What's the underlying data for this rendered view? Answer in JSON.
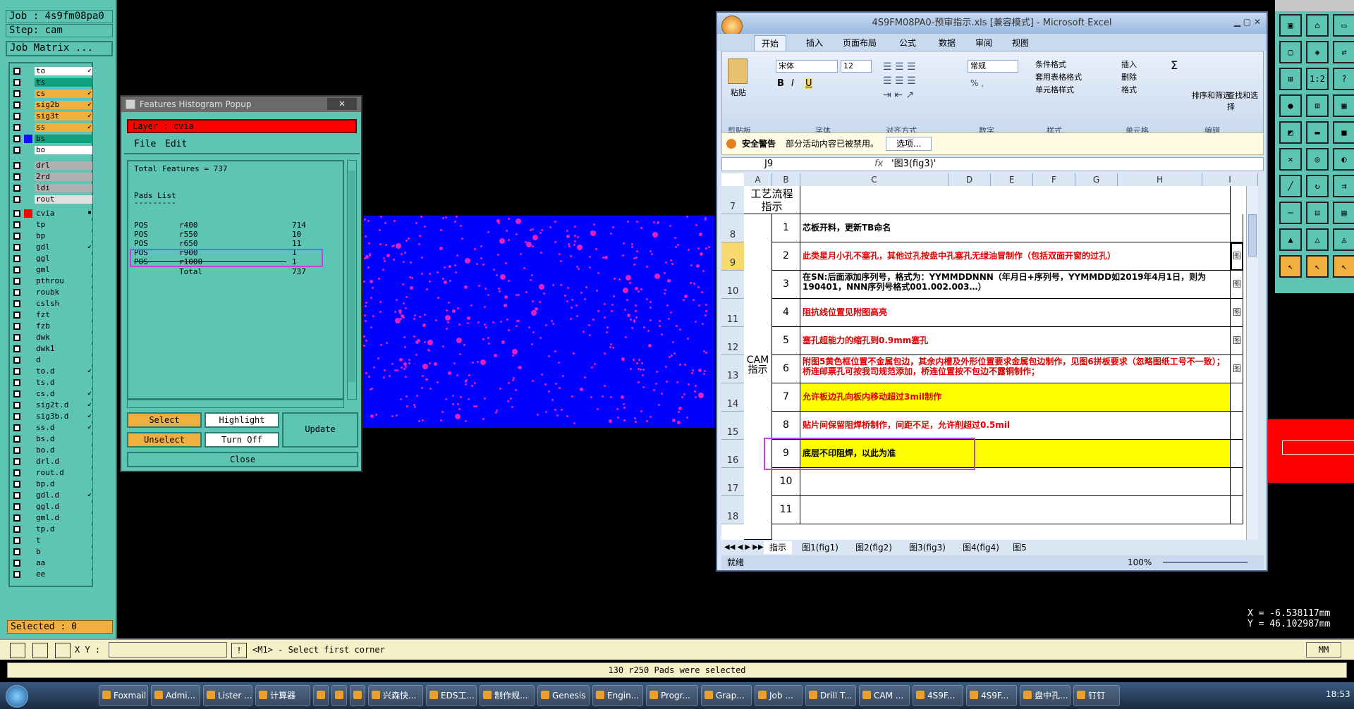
{
  "genesis": {
    "job": "Job : 4s9fm08pa0",
    "step": "Step: cam",
    "matrix": "Job Matrix ...",
    "selected": "Selected : 0",
    "layers": [
      {
        "name": "to",
        "bg": "#ffffff",
        "sw": "",
        "mk": "↙"
      },
      {
        "name": "ts",
        "bg": "#10a080",
        "sw": "",
        "mk": ""
      },
      {
        "name": "cs",
        "bg": "#f0b040",
        "sw": "",
        "mk": "↙"
      },
      {
        "name": "sig2b",
        "bg": "#f0b040",
        "sw": "",
        "mk": "↙"
      },
      {
        "name": "sig3t",
        "bg": "#f0b040",
        "sw": "",
        "mk": "↙"
      },
      {
        "name": "ss",
        "bg": "#f0b040",
        "sw": "",
        "mk": "↙"
      },
      {
        "name": "bs",
        "bg": "#10a080",
        "sw": "#1010ff",
        "mk": ""
      },
      {
        "name": "bo",
        "bg": "#ffffff",
        "sw": "",
        "mk": ""
      },
      {
        "name": "drl",
        "bg": "#b0b0b0",
        "sw": "",
        "mk": ""
      },
      {
        "name": "2rd",
        "bg": "#b0b0b0",
        "sw": "",
        "mk": ""
      },
      {
        "name": "ldi",
        "bg": "#b0b0b0",
        "sw": "",
        "mk": ""
      },
      {
        "name": "rout",
        "bg": "#e0e0e0",
        "sw": "",
        "mk": ""
      },
      {
        "name": "cvia",
        "bg": "#5ec4b4",
        "sw": "#ff0000",
        "mk": "▪"
      },
      {
        "name": "tp",
        "bg": "#5ec4b4",
        "sw": "",
        "mk": ""
      },
      {
        "name": "bp",
        "bg": "#5ec4b4",
        "sw": "",
        "mk": ""
      },
      {
        "name": "gdl",
        "bg": "#5ec4b4",
        "sw": "",
        "mk": "↙"
      },
      {
        "name": "ggl",
        "bg": "#5ec4b4",
        "sw": "",
        "mk": ""
      },
      {
        "name": "gml",
        "bg": "#5ec4b4",
        "sw": "",
        "mk": ""
      },
      {
        "name": "pthrou",
        "bg": "#5ec4b4",
        "sw": "",
        "mk": ""
      },
      {
        "name": "roubk",
        "bg": "#5ec4b4",
        "sw": "",
        "mk": ""
      },
      {
        "name": "cslsh",
        "bg": "#5ec4b4",
        "sw": "",
        "mk": ""
      },
      {
        "name": "fzt",
        "bg": "#5ec4b4",
        "sw": "",
        "mk": ""
      },
      {
        "name": "fzb",
        "bg": "#5ec4b4",
        "sw": "",
        "mk": ""
      },
      {
        "name": "dwk",
        "bg": "#5ec4b4",
        "sw": "",
        "mk": ""
      },
      {
        "name": "dwk1",
        "bg": "#5ec4b4",
        "sw": "",
        "mk": ""
      },
      {
        "name": "d",
        "bg": "#5ec4b4",
        "sw": "",
        "mk": ""
      },
      {
        "name": "to.d",
        "bg": "#5ec4b4",
        "sw": "",
        "mk": "↙"
      },
      {
        "name": "ts.d",
        "bg": "#5ec4b4",
        "sw": "",
        "mk": ""
      },
      {
        "name": "cs.d",
        "bg": "#5ec4b4",
        "sw": "",
        "mk": "↙"
      },
      {
        "name": "sig2t.d",
        "bg": "#5ec4b4",
        "sw": "",
        "mk": "↙"
      },
      {
        "name": "sig3b.d",
        "bg": "#5ec4b4",
        "sw": "",
        "mk": "↙"
      },
      {
        "name": "ss.d",
        "bg": "#5ec4b4",
        "sw": "",
        "mk": "↙"
      },
      {
        "name": "bs.d",
        "bg": "#5ec4b4",
        "sw": "",
        "mk": ""
      },
      {
        "name": "bo.d",
        "bg": "#5ec4b4",
        "sw": "",
        "mk": ""
      },
      {
        "name": "drl.d",
        "bg": "#5ec4b4",
        "sw": "",
        "mk": ""
      },
      {
        "name": "rout.d",
        "bg": "#5ec4b4",
        "sw": "",
        "mk": ""
      },
      {
        "name": "bp.d",
        "bg": "#5ec4b4",
        "sw": "",
        "mk": ""
      },
      {
        "name": "gdl.d",
        "bg": "#5ec4b4",
        "sw": "",
        "mk": "↙"
      },
      {
        "name": "ggl.d",
        "bg": "#5ec4b4",
        "sw": "",
        "mk": ""
      },
      {
        "name": "gml.d",
        "bg": "#5ec4b4",
        "sw": "",
        "mk": ""
      },
      {
        "name": "tp.d",
        "bg": "#5ec4b4",
        "sw": "",
        "mk": ""
      },
      {
        "name": "t",
        "bg": "#5ec4b4",
        "sw": "",
        "mk": ""
      },
      {
        "name": "b",
        "bg": "#5ec4b4",
        "sw": "",
        "mk": ""
      },
      {
        "name": "aa",
        "bg": "#5ec4b4",
        "sw": "",
        "mk": ""
      },
      {
        "name": "ee",
        "bg": "#5ec4b4",
        "sw": "",
        "mk": ""
      }
    ]
  },
  "histogram": {
    "title": "Features Histogram Popup",
    "close_x": "✕",
    "layer": "Layer :  cvia",
    "menu_file": "File",
    "menu_edit": "Edit",
    "total": "Total Features = 737",
    "pads_list": "Pads List",
    "pads_underline": "---------",
    "rows": [
      {
        "type": "POS",
        "size": "r400",
        "count": "714"
      },
      {
        "type": "POS",
        "size": "r550",
        "count": "10"
      },
      {
        "type": "POS",
        "size": "r650",
        "count": "11"
      },
      {
        "type": "POS",
        "size": "r900",
        "count": "1"
      },
      {
        "type": "POS",
        "size": "r1000",
        "count": "1"
      }
    ],
    "total_label": "Total",
    "total_value": "737",
    "btn_select": "Select",
    "btn_highlight": "Highlight",
    "btn_update": "Update",
    "btn_unselect": "Unselect",
    "btn_turnoff": "Turn Off",
    "btn_close": "Close"
  },
  "excel": {
    "title": "4S9FM08PA0-预审指示.xls  [兼容模式] - Microsoft Excel",
    "tabs": [
      "开始",
      "插入",
      "页面布局",
      "公式",
      "数据",
      "审阅",
      "视图"
    ],
    "font_name": "宋体",
    "font_size": "12",
    "number_format": "常规",
    "groups": [
      "剪贴板",
      "字体",
      "对齐方式",
      "数字",
      "样式",
      "单元格",
      "编辑"
    ],
    "paste": "粘贴",
    "cond_format": "条件格式",
    "table_format": "套用表格格式",
    "cell_style": "单元格样式",
    "insert": "插入",
    "delete": "删除",
    "format": "格式",
    "sort_filter": "排序和筛选",
    "find_select": "查找和选择",
    "security_label": "安全警告",
    "security_msg": "部分活动内容已被禁用。",
    "options_btn": "选项...",
    "namebox": "J9",
    "formula": "'图3(fig3)'",
    "fx": "fx",
    "columns": [
      "A",
      "B",
      "C",
      "D",
      "E",
      "F",
      "G",
      "H",
      "I"
    ],
    "row_numbers": [
      "7",
      "8",
      "9",
      "10",
      "11",
      "12",
      "13",
      "14",
      "15",
      "16",
      "17",
      "18"
    ],
    "header_cell": "工艺流程指示",
    "cam_label": "CAM指示",
    "items": [
      {
        "n": "1",
        "text": "芯板开料，更新TB命名",
        "color": "#000000",
        "bg": "#ffffff",
        "side": ""
      },
      {
        "n": "2",
        "text": "此类星月小孔不塞孔，其他过孔按盘中孔塞孔无绿油冒制作（包括双面开窗的过孔）",
        "color": "#e00000",
        "bg": "#ffffff",
        "side": "图"
      },
      {
        "n": "3",
        "text": "在SN:后面添加序列号，格式为：YYMMDDNNN（年月日+序列号，YYMMDD如2019年4月1日，则为190401，NNN序列号格式001.002.003…）",
        "color": "#000000",
        "bg": "#ffffff",
        "side": "图"
      },
      {
        "n": "4",
        "text": "阻抗线位置见附图高亮",
        "color": "#e00000",
        "bg": "#ffffff",
        "side": "图"
      },
      {
        "n": "5",
        "text": "塞孔超能力的缩孔到0.9mm塞孔",
        "color": "#e00000",
        "bg": "#ffffff",
        "side": "图"
      },
      {
        "n": "6",
        "text": "附图5黄色框位置不金属包边，其余内槽及外形位置要求金属包边制作，见图6拼板要求（忽略图纸工号不一致）；桥连邮票孔可按我司规范添加，桥连位置按不包边不露铜制作；",
        "color": "#e00000",
        "bg": "#ffffff",
        "side": "图"
      },
      {
        "n": "7",
        "text": "允许板边孔向板内移动超过3mil制作",
        "color": "#e00000",
        "bg": "#ffff00",
        "side": ""
      },
      {
        "n": "8",
        "text": "贴片间保留阻焊桥制作，间距不足，允许削超过0.5mil",
        "color": "#e00000",
        "bg": "#ffffff",
        "side": ""
      },
      {
        "n": "9",
        "text": "底层不印阻焊，以此为准",
        "color": "#000000",
        "bg": "#ffff00",
        "side": ""
      },
      {
        "n": "10",
        "text": "",
        "color": "#000000",
        "bg": "#ffffff",
        "side": ""
      },
      {
        "n": "11",
        "text": "",
        "color": "#000000",
        "bg": "#ffffff",
        "side": ""
      }
    ],
    "sheets": [
      "指示",
      "图1(fig1)",
      "图2(fig2)",
      "图3(fig3)",
      "图4(fig4)",
      "图5"
    ],
    "status": "就绪",
    "zoom": "100%"
  },
  "bottom": {
    "xy_label": "X Y :",
    "xy_value": "",
    "prompt": "<M1> - Select first corner",
    "message": "130 r250 Pads were selected",
    "coords": "X = -6.538117mm\nY = 46.102987mm",
    "units": "MM"
  },
  "taskbar": {
    "items": [
      "Foxmail",
      "Admi...",
      "Lister ...",
      "计算器",
      "",
      "",
      "",
      "兴森快...",
      "EDS工...",
      "制作规...",
      "Genesis",
      "Engin...",
      "Progr...",
      "Grap...",
      "Job ...",
      "Drill T...",
      "CAM ...",
      "4S9F...",
      "4S9F...",
      "盘中孔...",
      "钉钉"
    ],
    "clock": "18:53"
  },
  "colors": {
    "teal": "#5ec4b4",
    "blue_canvas": "#0000ff",
    "pad": "#e020c0",
    "highlight_box": "#c040e0"
  }
}
